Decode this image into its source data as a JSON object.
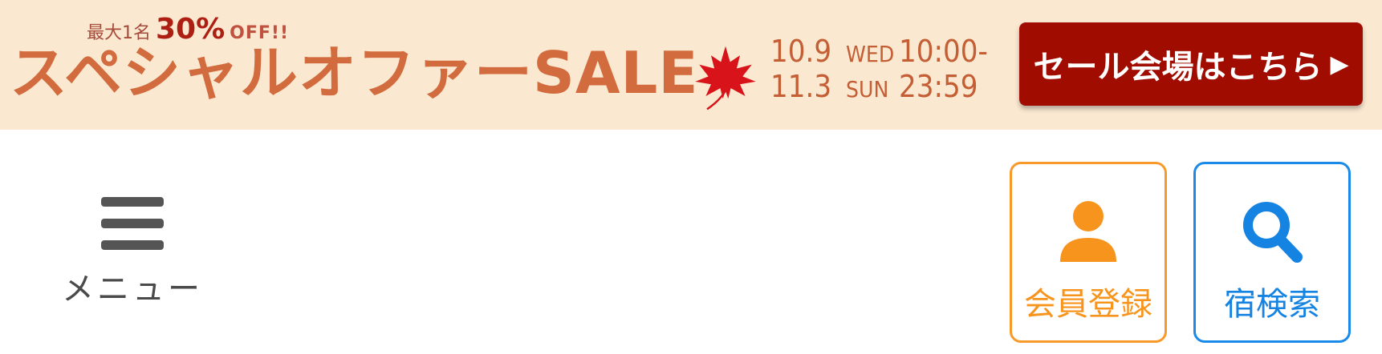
{
  "banner": {
    "promo_prefix": "最大1名",
    "promo_percent": "30%",
    "promo_off": "OFF!!",
    "title": "スペシャルオファーSALE",
    "maple_icon": "maple-leaf-icon",
    "dates": [
      {
        "date": "10.9",
        "weekday": "WED",
        "time": "10:00-"
      },
      {
        "date": "11.3",
        "weekday": "SUN",
        "time": "23:59"
      }
    ],
    "cta_label": "セール会場はこちら",
    "cta_arrow": "▶",
    "colors": {
      "background": "#fae8d1",
      "title": "#d26b3d",
      "cta": "#a00d00",
      "accent": "#ad1f12"
    }
  },
  "header": {
    "menu": {
      "label": "メニュー",
      "icon": "hamburger-icon"
    },
    "member": {
      "label": "会員登録",
      "icon": "user-icon",
      "color": "#f7941d"
    },
    "search": {
      "label": "宿検索",
      "icon": "search-icon",
      "color": "#1583e2"
    }
  }
}
